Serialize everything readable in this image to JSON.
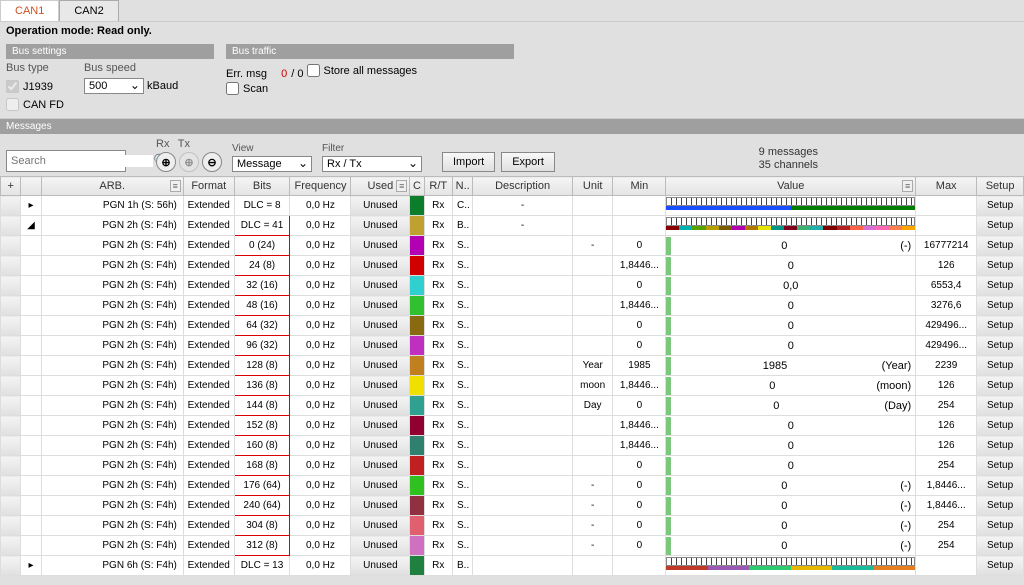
{
  "tabs": [
    "CAN1",
    "CAN2"
  ],
  "activeTab": 0,
  "opMode": "Operation mode: Read only.",
  "busSettings": {
    "title": "Bus settings",
    "busType": "Bus type",
    "j1939": "J1939",
    "canfd": "CAN FD",
    "busSpeed": "Bus speed",
    "speedVal": "500",
    "kbaud": "kBaud"
  },
  "busTraffic": {
    "title": "Bus traffic",
    "errMsg": "Err. msg",
    "err0": "0",
    "errRest": "/ 0",
    "storeAll": "Store all messages",
    "scan": "Scan"
  },
  "messagesTitle": "Messages",
  "toolbar": {
    "rx": "Rx",
    "tx": "Tx",
    "view": "View",
    "viewVal": "Message",
    "filter": "Filter",
    "filterVal": "Rx / Tx",
    "import": "Import",
    "export": "Export",
    "searchPlaceholder": "Search",
    "msgCount": "9 messages",
    "chCount": "35 channels",
    "plus": "+"
  },
  "cols": {
    "arb": "ARB.",
    "format": "Format",
    "bits": "Bits",
    "freq": "Frequency",
    "used": "Used",
    "c": "C",
    "rt": "R/T",
    "n": "N..",
    "desc": "Description",
    "unit": "Unit",
    "min": "Min",
    "value": "Value",
    "max": "Max",
    "setup": "Setup"
  },
  "used": "Unused",
  "setup": "Setup",
  "fmt": "Extended",
  "rows": [
    {
      "exp": "▸",
      "arb": "PGN 1h (S: 56h)",
      "bits": "DLC = 8",
      "freq": "0,0 Hz",
      "color": "#0b7d2b",
      "rt": "Rx",
      "n": "C..",
      "desc": "-",
      "unit": "",
      "min": "",
      "valueType": "bits",
      "bitsColors": [
        "#1a4fff",
        "#007e00"
      ],
      "max": "",
      "hl": false
    },
    {
      "exp": "◢",
      "arb": "PGN 2h (S: F4h)",
      "bits": "DLC = 41",
      "freq": "0,0 Hz",
      "color": "#c0a030",
      "rt": "Rx",
      "n": "B..",
      "desc": "-",
      "unit": "",
      "min": "",
      "valueType": "bits",
      "bitsColors": [
        "#8a0000",
        "#00b2b2",
        "#5aa200",
        "#b7a100",
        "#7b5c00",
        "#b200b2",
        "#b27800",
        "#e6e600",
        "#009688",
        "#800020",
        "#3cb371",
        "#20b2aa",
        "#800000",
        "#b22222",
        "#ff6347",
        "#da70d6",
        "#ff69b4",
        "#ff7f50",
        "#ffa500"
      ],
      "max": "",
      "hl": true
    },
    {
      "exp": "",
      "arb": "PGN 2h (S: F4h)",
      "bits": "0 (24)",
      "freq": "0,0 Hz",
      "color": "#b200b2",
      "rt": "Rx",
      "n": "S..",
      "desc": "",
      "unit": "-",
      "min": "0",
      "valueType": "bar",
      "val": "0",
      "rval": "(-)",
      "max": "16777214",
      "hl": true
    },
    {
      "exp": "",
      "arb": "PGN 2h (S: F4h)",
      "bits": "24 (8)",
      "freq": "0,0 Hz",
      "color": "#d00000",
      "rt": "Rx",
      "n": "S..",
      "desc": "",
      "unit": "",
      "min": "1,8446...",
      "valueType": "bar",
      "val": "0",
      "rval": "",
      "max": "126",
      "hl": true
    },
    {
      "exp": "",
      "arb": "PGN 2h (S: F4h)",
      "bits": "32 (16)",
      "freq": "0,0 Hz",
      "color": "#30d0d0",
      "rt": "Rx",
      "n": "S..",
      "desc": "",
      "unit": "",
      "min": "0",
      "valueType": "bar",
      "val": "0,0",
      "rval": "",
      "max": "6553,4",
      "hl": true
    },
    {
      "exp": "",
      "arb": "PGN 2h (S: F4h)",
      "bits": "48 (16)",
      "freq": "0,0 Hz",
      "color": "#30c030",
      "rt": "Rx",
      "n": "S..",
      "desc": "",
      "unit": "",
      "min": "1,8446...",
      "valueType": "bar",
      "val": "0",
      "rval": "",
      "max": "3276,6",
      "hl": true
    },
    {
      "exp": "",
      "arb": "PGN 2h (S: F4h)",
      "bits": "64 (32)",
      "freq": "0,0 Hz",
      "color": "#8a6a10",
      "rt": "Rx",
      "n": "S..",
      "desc": "",
      "unit": "",
      "min": "0",
      "valueType": "bar",
      "val": "0",
      "rval": "",
      "max": "429496...",
      "hl": true
    },
    {
      "exp": "",
      "arb": "PGN 2h (S: F4h)",
      "bits": "96 (32)",
      "freq": "0,0 Hz",
      "color": "#c030c0",
      "rt": "Rx",
      "n": "S..",
      "desc": "",
      "unit": "",
      "min": "0",
      "valueType": "bar",
      "val": "0",
      "rval": "",
      "max": "429496...",
      "hl": true
    },
    {
      "exp": "",
      "arb": "PGN 2h (S: F4h)",
      "bits": "128 (8)",
      "freq": "0,0 Hz",
      "color": "#c08020",
      "rt": "Rx",
      "n": "S..",
      "desc": "",
      "unit": "Year",
      "min": "1985",
      "valueType": "bar",
      "val": "1985",
      "rval": "(Year)",
      "max": "2239",
      "hl": true
    },
    {
      "exp": "",
      "arb": "PGN 2h (S: F4h)",
      "bits": "136 (8)",
      "freq": "0,0 Hz",
      "color": "#f0e000",
      "rt": "Rx",
      "n": "S..",
      "desc": "",
      "unit": "moon",
      "min": "1,8446...",
      "valueType": "bar",
      "val": "0",
      "rval": "(moon)",
      "max": "126",
      "hl": true
    },
    {
      "exp": "",
      "arb": "PGN 2h (S: F4h)",
      "bits": "144 (8)",
      "freq": "0,0 Hz",
      "color": "#30a090",
      "rt": "Rx",
      "n": "S..",
      "desc": "",
      "unit": "Day",
      "min": "0",
      "valueType": "bar",
      "val": "0",
      "rval": "(Day)",
      "max": "254",
      "hl": true
    },
    {
      "exp": "",
      "arb": "PGN 2h (S: F4h)",
      "bits": "152 (8)",
      "freq": "0,0 Hz",
      "color": "#900030",
      "rt": "Rx",
      "n": "S..",
      "desc": "",
      "unit": "",
      "min": "1,8446...",
      "valueType": "bar",
      "val": "0",
      "rval": "",
      "max": "126",
      "hl": true
    },
    {
      "exp": "",
      "arb": "PGN 2h (S: F4h)",
      "bits": "160 (8)",
      "freq": "0,0 Hz",
      "color": "#308070",
      "rt": "Rx",
      "n": "S..",
      "desc": "",
      "unit": "",
      "min": "1,8446...",
      "valueType": "bar",
      "val": "0",
      "rval": "",
      "max": "126",
      "hl": true
    },
    {
      "exp": "",
      "arb": "PGN 2h (S: F4h)",
      "bits": "168 (8)",
      "freq": "0,0 Hz",
      "color": "#c02020",
      "rt": "Rx",
      "n": "S..",
      "desc": "",
      "unit": "",
      "min": "0",
      "valueType": "bar",
      "val": "0",
      "rval": "",
      "max": "254",
      "hl": true
    },
    {
      "exp": "",
      "arb": "PGN 2h (S: F4h)",
      "bits": "176 (64)",
      "freq": "0,0 Hz",
      "color": "#30c020",
      "rt": "Rx",
      "n": "S..",
      "desc": "",
      "unit": "-",
      "min": "0",
      "valueType": "bar",
      "val": "0",
      "rval": "(-)",
      "max": "1,8446...",
      "hl": true
    },
    {
      "exp": "",
      "arb": "PGN 2h (S: F4h)",
      "bits": "240 (64)",
      "freq": "0,0 Hz",
      "color": "#903040",
      "rt": "Rx",
      "n": "S..",
      "desc": "",
      "unit": "-",
      "min": "0",
      "valueType": "bar",
      "val": "0",
      "rval": "(-)",
      "max": "1,8446...",
      "hl": true
    },
    {
      "exp": "",
      "arb": "PGN 2h (S: F4h)",
      "bits": "304 (8)",
      "freq": "0,0 Hz",
      "color": "#e06070",
      "rt": "Rx",
      "n": "S..",
      "desc": "",
      "unit": "-",
      "min": "0",
      "valueType": "bar",
      "val": "0",
      "rval": "(-)",
      "max": "254",
      "hl": true
    },
    {
      "exp": "",
      "arb": "PGN 2h (S: F4h)",
      "bits": "312 (8)",
      "freq": "0,0 Hz",
      "color": "#d070c0",
      "rt": "Rx",
      "n": "S..",
      "desc": "",
      "unit": "-",
      "min": "0",
      "valueType": "bar",
      "val": "0",
      "rval": "(-)",
      "max": "254",
      "hl": true
    },
    {
      "exp": "▸",
      "arb": "PGN 6h (S: F4h)",
      "bits": "DLC = 13",
      "freq": "0,0 Hz",
      "color": "#208040",
      "rt": "Rx",
      "n": "B..",
      "desc": "",
      "unit": "",
      "min": "",
      "valueType": "bits",
      "bitsColors": [
        "#c0392b",
        "#9b59b6",
        "#2ecc71",
        "#e6b800",
        "#1abc9c",
        "#e67e22"
      ],
      "max": "",
      "hl": false
    }
  ]
}
